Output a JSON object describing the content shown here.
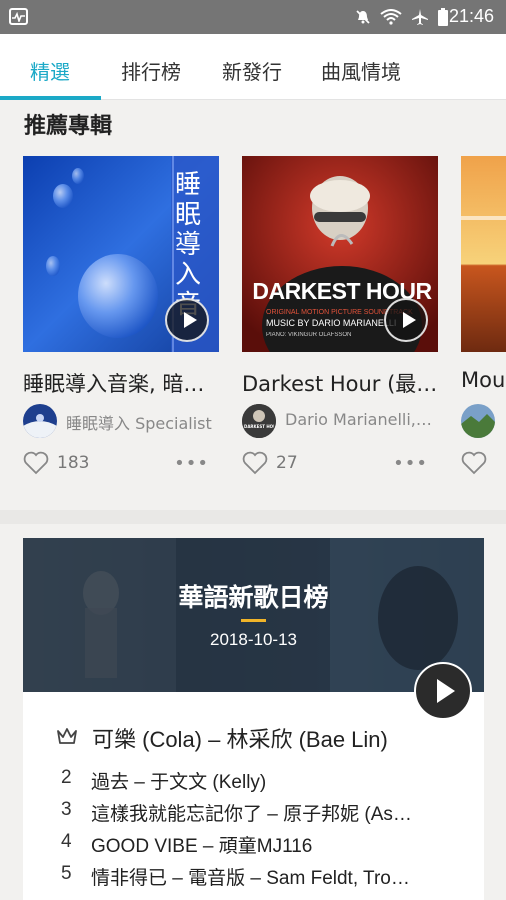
{
  "status_bar": {
    "time": "21:46"
  },
  "tabs": [
    {
      "label": "精選",
      "active": true
    },
    {
      "label": "排行榜"
    },
    {
      "label": "新發行"
    },
    {
      "label": "曲風情境"
    }
  ],
  "recommended": {
    "title": "推薦專輯",
    "albums": [
      {
        "title": "睡眠導入音楽, 暗…",
        "artist": "睡眠導入 Specialist",
        "likes": "183",
        "cover_text": "睡眠導入音"
      },
      {
        "title": "Darkest Hour (最…",
        "artist": "Dario Marianelli,…",
        "likes": "27",
        "cover_text": "DARKEST HOUR",
        "cover_subtitle": "ORIGINAL MOTION PICTURE SOUNDTRACK",
        "cover_credit": "MUSIC BY DARIO MARIANELLI",
        "cover_piano": "PIANO: VÍKINGUR ÓLAFSSON",
        "avatar_text": "DARKEST HOUR"
      },
      {
        "title": "Mou",
        "artist": "",
        "likes": ""
      }
    ]
  },
  "chart": {
    "title": "華語新歌日榜",
    "date": "2018-10-13",
    "top": "可樂 (Cola) – 林采欣 (Bae Lin)",
    "entries": [
      {
        "rank": "2",
        "song": "過去 – 于文文 (Kelly)"
      },
      {
        "rank": "3",
        "song": "這樣我就能忘記你了 – 原子邦妮 (As…"
      },
      {
        "rank": "4",
        "song": "GOOD VIBE – 頑童MJ116"
      },
      {
        "rank": "5",
        "song": "情非得已 – 電音版 – Sam Feldt, Tro…"
      }
    ]
  },
  "colors": {
    "accent": "#1ba9c7",
    "status_bar": "#757575",
    "chart_accent": "#f0b429"
  }
}
